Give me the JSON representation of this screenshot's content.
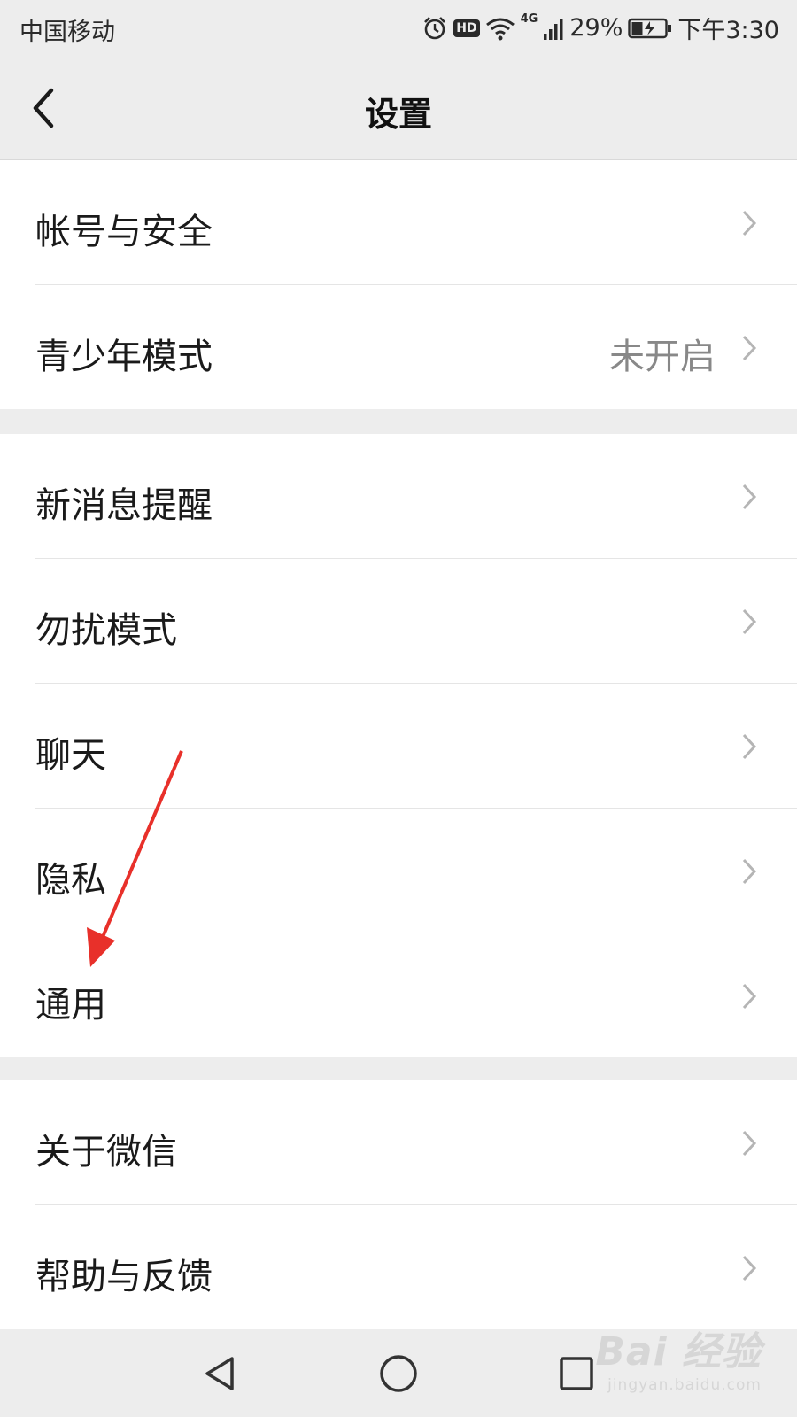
{
  "status_bar": {
    "carrier": "中国移动",
    "network": "4G",
    "hd": "HD",
    "battery": "29%",
    "time": "下午3:30"
  },
  "header": {
    "title": "设置"
  },
  "groups": [
    {
      "items": [
        {
          "label": "帐号与安全"
        },
        {
          "label": "青少年模式",
          "value": "未开启"
        }
      ]
    },
    {
      "items": [
        {
          "label": "新消息提醒"
        },
        {
          "label": "勿扰模式"
        },
        {
          "label": "聊天"
        },
        {
          "label": "隐私"
        },
        {
          "label": "通用"
        }
      ]
    },
    {
      "items": [
        {
          "label": "关于微信"
        },
        {
          "label": "帮助与反馈"
        }
      ]
    }
  ],
  "watermark": {
    "main": "Bai 经验",
    "sub": "jingyan.baidu.com"
  },
  "colors": {
    "background": "#ededed",
    "annotation_arrow": "#e8302a"
  }
}
